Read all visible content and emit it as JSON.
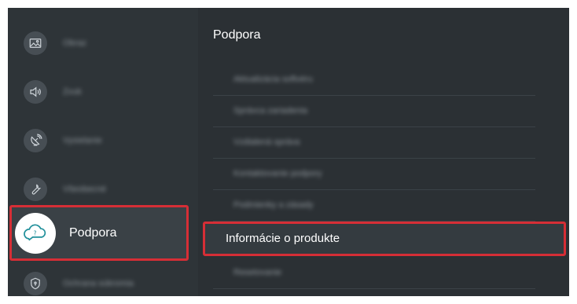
{
  "left_menu": {
    "items": [
      {
        "label": "Obraz",
        "icon": "picture-icon"
      },
      {
        "label": "Zvuk",
        "icon": "sound-icon"
      },
      {
        "label": "Vysielanie",
        "icon": "broadcast-icon"
      },
      {
        "label": "Všeobecné",
        "icon": "wrench-icon"
      },
      {
        "label": "Podpora",
        "icon": "support-cloud-icon",
        "selected": true
      },
      {
        "label": "Ochrana súkromia",
        "icon": "privacy-shield-icon"
      }
    ]
  },
  "right_panel": {
    "title": "Podpora",
    "items": [
      {
        "label": "Aktualizácia softvéru"
      },
      {
        "label": "Správca zariadenia"
      },
      {
        "label": "Vzdialená správa"
      },
      {
        "label": "Kontaktovanie podpory"
      },
      {
        "label": "Podmienky a zásady"
      },
      {
        "label": "Informácie o produkte",
        "selected": true
      },
      {
        "label": "Resetovanie"
      }
    ]
  },
  "colors": {
    "accent": "#d62e36",
    "background": "#2c3136"
  }
}
